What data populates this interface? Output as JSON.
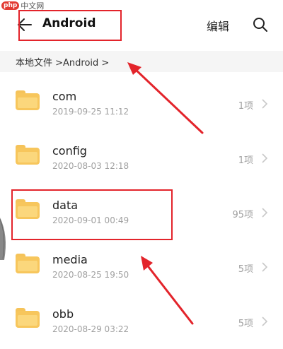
{
  "watermark": {
    "logo": "php",
    "text": "中文网"
  },
  "header": {
    "title": "Android",
    "back_icon": "arrow-left-icon",
    "edit_label": "编辑",
    "search_icon": "search-icon"
  },
  "breadcrumb": {
    "path": "本地文件 >Android >"
  },
  "folders": [
    {
      "name": "com",
      "date": "2019-09-25 11:12",
      "count": "1项"
    },
    {
      "name": "config",
      "date": "2020-08-03 12:18",
      "count": "1项"
    },
    {
      "name": "data",
      "date": "2020-09-01 00:49",
      "count": "95项"
    },
    {
      "name": "media",
      "date": "2020-08-25 19:50",
      "count": "5项"
    },
    {
      "name": "obb",
      "date": "2020-08-29 03:22",
      "count": "5项"
    }
  ],
  "colors": {
    "highlight": "#e3242b",
    "folder": "#f7c65c",
    "separator_bg": "#f5f5f5"
  }
}
